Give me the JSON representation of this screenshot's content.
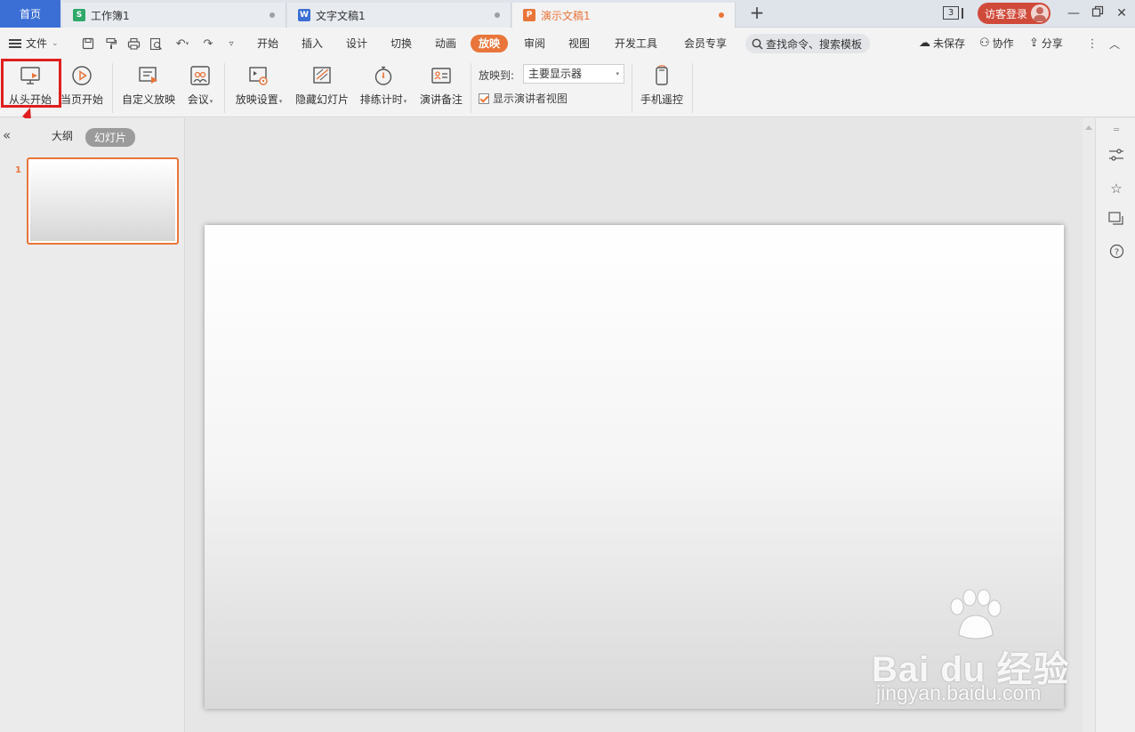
{
  "tabs": {
    "home": "首页",
    "docs": [
      {
        "label": "工作簿1",
        "icon_letter": "S",
        "icon_color": "#2fa86a"
      },
      {
        "label": "文字文稿1",
        "icon_letter": "W",
        "icon_color": "#3c6fd6"
      },
      {
        "label": "演示文稿1",
        "icon_letter": "P",
        "icon_color": "#e9753a"
      }
    ],
    "new_tab_icon": "plus-icon",
    "window_count": "3",
    "login_label": "访客登录"
  },
  "menu": {
    "file_label": "文件",
    "tabs": [
      "开始",
      "插入",
      "设计",
      "切换",
      "动画",
      "放映",
      "审阅",
      "视图",
      "开发工具",
      "会员专享"
    ],
    "active_tab": "放映",
    "search_placeholder": "查找命令、搜索模板",
    "unsaved_label": "未保存",
    "collab_label": "协作",
    "share_label": "分享"
  },
  "ribbon": {
    "from_start": "从头开始",
    "from_current": "当页开始",
    "custom_show": "自定义放映",
    "meeting": "会议",
    "show_settings": "放映设置",
    "hide_slide": "隐藏幻灯片",
    "rehearse": "排练计时",
    "speaker_notes": "演讲备注",
    "show_on_label": "放映到:",
    "show_on_value": "主要显示器",
    "presenter_view_label": "显示演讲者视图",
    "presenter_view_checked": true,
    "phone_remote": "手机遥控"
  },
  "left_panel": {
    "outline_tab": "大纲",
    "slides_tab": "幻灯片",
    "slide_number": "1"
  },
  "watermark": {
    "brand": "Bai du 经验",
    "url": "jingyan.baidu.com"
  },
  "colors": {
    "accent": "#e9753a",
    "home_tab": "#3c6fd6",
    "highlight": "#e01e1e"
  }
}
